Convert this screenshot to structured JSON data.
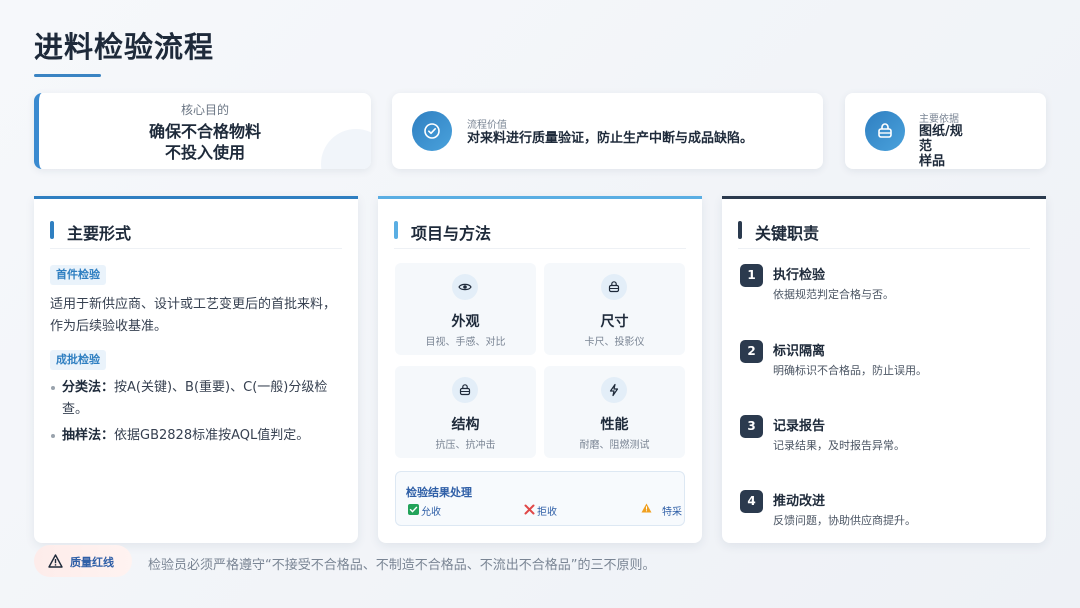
{
  "title": "进料检验流程",
  "top": {
    "card1": {
      "label": "核心目的",
      "text_line1": "确保不合格物料",
      "text_line2": "不投入使用"
    },
    "card2": {
      "label": "流程价值",
      "text": "对来料进行质量验证，防止生产中断与成品缺陷。",
      "icon": "check-circle-icon"
    },
    "card3": {
      "label": "主要依据",
      "text_line1": "图纸/规",
      "text_line2": "范",
      "text_line3": "样品",
      "icon": "box-icon"
    }
  },
  "panel1": {
    "heading": "主要形式",
    "tag1": "首件检验",
    "desc": "适用于新供应商、设计或工艺变更后的首批来料，作为后续验收基准。",
    "tag2": "成批检验",
    "bullets": [
      {
        "label": "分类法：",
        "text": "按A(关键)、B(重要)、C(一般)分级检查。"
      },
      {
        "label": "抽样法：",
        "text": "依据GB2828标准按AQL值判定。"
      }
    ]
  },
  "panel2": {
    "heading": "项目与方法",
    "items": [
      {
        "title": "外观",
        "sub": "目视、手感、对比",
        "icon": "eye-icon"
      },
      {
        "title": "尺寸",
        "sub": "卡尺、投影仪",
        "icon": "box-icon"
      },
      {
        "title": "结构",
        "sub": "抗压、抗冲击",
        "icon": "box-icon"
      },
      {
        "title": "性能",
        "sub": "耐磨、阻燃测试",
        "icon": "bolt-icon"
      }
    ],
    "result": {
      "title": "检验结果处理",
      "accept": "允收",
      "reject": "拒收",
      "special": "特采"
    }
  },
  "panel3": {
    "heading": "关键职责",
    "steps": [
      {
        "num": "1",
        "title": "执行检验",
        "desc": "依据规范判定合格与否。"
      },
      {
        "num": "2",
        "title": "标识隔离",
        "desc": "明确标识不合格品，防止误用。"
      },
      {
        "num": "3",
        "title": "记录报告",
        "desc": "记录结果，及时报告异常。"
      },
      {
        "num": "4",
        "title": "推动改进",
        "desc": "反馈问题，协助供应商提升。"
      }
    ]
  },
  "footer": {
    "badge": "质量红线",
    "text": "检验员必须严格遵守“不接受不合格品、不制造不合格品、不流出不合格品”的三不原则。"
  },
  "colors": {
    "accent": "#2f7fc1",
    "light_accent": "#5aaee3",
    "dark": "#2b3a4e",
    "accept_green": "#22a35a",
    "reject_red": "#e04848",
    "warn_orange": "#f0a020"
  }
}
